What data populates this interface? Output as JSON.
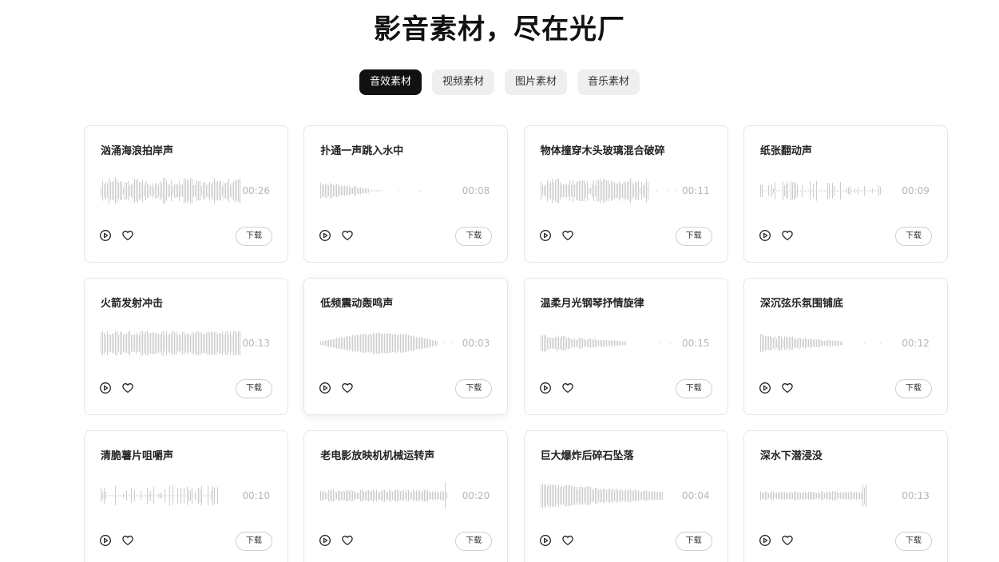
{
  "hero": {
    "title": "影音素材，尽在光厂"
  },
  "tabs": [
    {
      "label": "音效素材",
      "active": true
    },
    {
      "label": "视频素材",
      "active": false
    },
    {
      "label": "图片素材",
      "active": false
    },
    {
      "label": "音乐素材",
      "active": false
    }
  ],
  "download_label": "下载",
  "icons": {
    "play": "play-circle-icon",
    "favorite": "heart-icon"
  },
  "colors": {
    "accent": "#111111",
    "waveform": "#c4c4c4",
    "duration": "#b5b5b5",
    "tab_bg": "#efefef"
  },
  "cards": [
    {
      "title": "汹涌海浪拍岸声",
      "duration": "00:26",
      "wave": {
        "seed": 3,
        "profile": "dense",
        "coverage": 1.0
      }
    },
    {
      "title": "扑通一声跳入水中",
      "duration": "00:08",
      "wave": {
        "seed": 7,
        "profile": "burst",
        "coverage": 0.45
      }
    },
    {
      "title": "物体撞穿木头玻璃混合破碎",
      "duration": "00:11",
      "wave": {
        "seed": 11,
        "profile": "dense",
        "coverage": 0.78
      }
    },
    {
      "title": "纸张翻动声",
      "duration": "00:09",
      "wave": {
        "seed": 5,
        "profile": "sparse",
        "coverage": 0.88
      }
    },
    {
      "title": "火箭发射冲击",
      "duration": "00:13",
      "wave": {
        "seed": 13,
        "profile": "loud",
        "coverage": 1.0
      }
    },
    {
      "title": "低频震动轰鸣声",
      "duration": "00:03",
      "wave": {
        "seed": 17,
        "profile": "bell",
        "coverage": 0.85
      }
    },
    {
      "title": "温柔月光钢琴抒情旋律",
      "duration": "00:15",
      "wave": {
        "seed": 19,
        "profile": "fade",
        "coverage": 0.62
      }
    },
    {
      "title": "深沉弦乐氛围铺底",
      "duration": "00:12",
      "wave": {
        "seed": 23,
        "profile": "fade",
        "coverage": 0.6
      }
    },
    {
      "title": "清脆薯片咀嚼声",
      "duration": "00:10",
      "wave": {
        "seed": 29,
        "profile": "sparse",
        "coverage": 0.85
      }
    },
    {
      "title": "老电影放映机机械运转声",
      "duration": "00:20",
      "wave": {
        "seed": 31,
        "profile": "steady",
        "coverage": 0.92
      }
    },
    {
      "title": "巨大爆炸后碎石坠落",
      "duration": "00:04",
      "wave": {
        "seed": 37,
        "profile": "decay",
        "coverage": 0.88
      }
    },
    {
      "title": "深水下潜浸没",
      "duration": "00:13",
      "wave": {
        "seed": 41,
        "profile": "swell",
        "coverage": 0.77
      }
    }
  ]
}
